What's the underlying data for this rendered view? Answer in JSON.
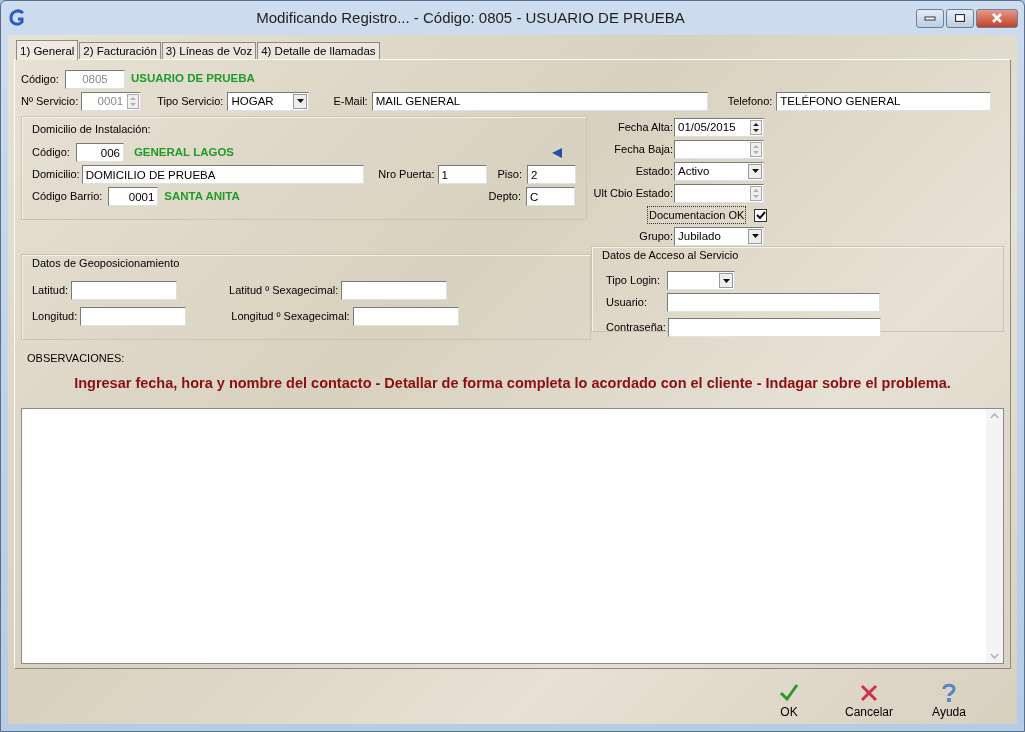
{
  "window": {
    "title": "Modificando Registro... - Código: 0805 - USUARIO DE PRUEBA"
  },
  "tabs": [
    {
      "label": "1) General",
      "selected": true
    },
    {
      "label": "2) Facturación",
      "selected": false
    },
    {
      "label": "3) Líneas de Voz",
      "selected": false
    },
    {
      "label": "4) Detalle de llamadas",
      "selected": false
    }
  ],
  "general": {
    "codigo": {
      "label": "Código:",
      "value": "0805",
      "description": "USUARIO DE PRUEBA",
      "disabled": true
    },
    "nro_servicio": {
      "label": "Nº Servicio:",
      "value": "0001",
      "disabled": true
    },
    "tipo_servicio": {
      "label": "Tipo Servicio:",
      "value": "HOGAR"
    },
    "email": {
      "label": "E-Mail:",
      "value": "MAIL GENERAL"
    },
    "telefono": {
      "label": "Telefono:",
      "value": "TELÉFONO GENERAL"
    }
  },
  "domicilio": {
    "title": "Domicilio de Instalación:",
    "codigo": {
      "label": "Código:",
      "value": "006",
      "description": "GENERAL LAGOS"
    },
    "domicilio": {
      "label": "Domicilio:",
      "value": "DOMICILIO DE PRUEBA"
    },
    "nro_puerta": {
      "label": "Nro Puerta:",
      "value": "1"
    },
    "piso": {
      "label": "Piso:",
      "value": "2"
    },
    "codigo_barrio": {
      "label": "Código Barrio:",
      "value": "0001",
      "description": "SANTA ANITA"
    },
    "depto": {
      "label": "Depto:",
      "value": "C"
    }
  },
  "estado_panel": {
    "fecha_alta": {
      "label": "Fecha Alta:",
      "value": "01/05/2015",
      "disabled": false
    },
    "fecha_baja": {
      "label": "Fecha Baja:",
      "disabled": true
    },
    "estado": {
      "label": "Estado:",
      "value": "Activo"
    },
    "ult_cbio_estado": {
      "label": "Ult Cbio Estado:",
      "disabled": true
    },
    "documentacion_ok": {
      "label": "Documentacion OK",
      "checked": true
    },
    "grupo": {
      "label": "Grupo:",
      "value": "Jubilado"
    }
  },
  "geo": {
    "title": "Datos de Geoposicionamiento",
    "latitud": {
      "label": "Latitud:"
    },
    "latitud_sexagecimal": {
      "label": "Latitud º Sexagecimal:"
    },
    "longitud": {
      "label": "Longitud:"
    },
    "longitud_sexagecimal": {
      "label": "Longitud º Sexagecimal:"
    }
  },
  "acceso": {
    "title": "Datos de Acceso al Servicio",
    "tipo_login": {
      "label": "Tipo Login:"
    },
    "usuario": {
      "label": "Usuario:"
    },
    "contrasena": {
      "label": "Contraseña:"
    }
  },
  "observaciones": {
    "label": "OBSERVACIONES:",
    "hint": "Ingresar fecha, hora y nombre del contacto - Detallar de forma completa lo acordado con el cliente - Indagar sobre el problema."
  },
  "buttons": [
    {
      "label": "OK",
      "kind": "ok"
    },
    {
      "label": "Cancelar",
      "kind": "cancel"
    },
    {
      "label": "Ayuda",
      "kind": "help"
    }
  ]
}
